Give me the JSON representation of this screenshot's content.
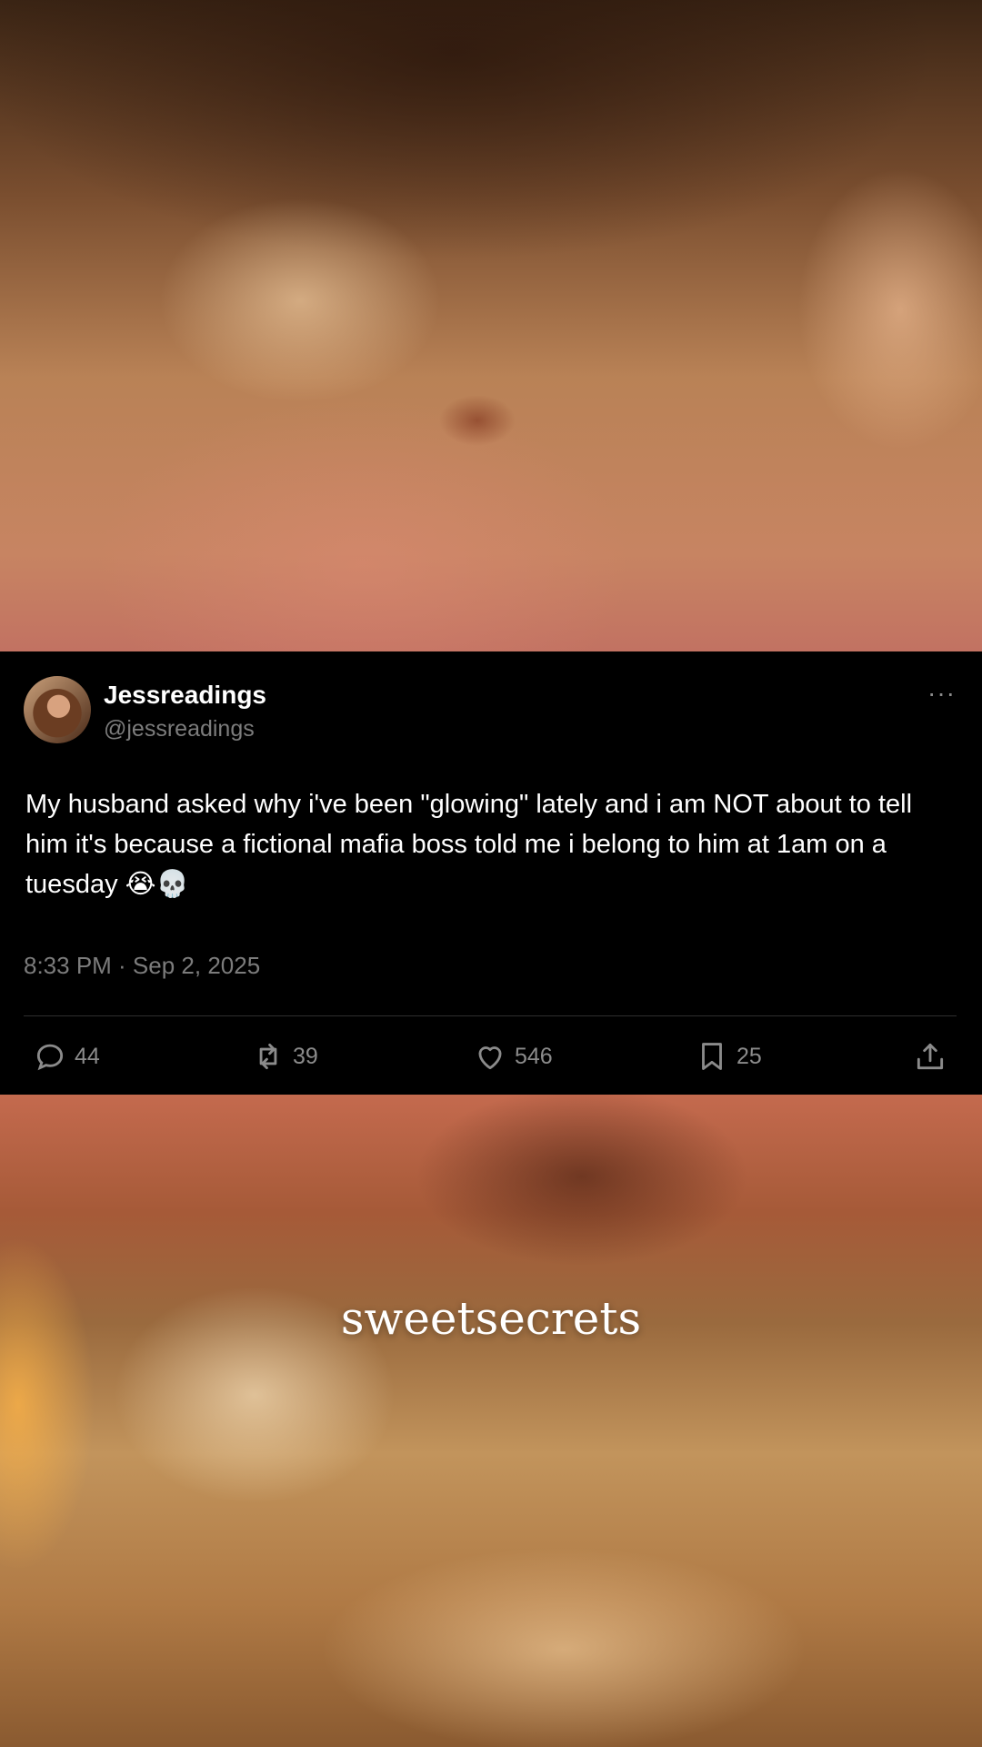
{
  "post": {
    "display_name": "Jessreadings",
    "handle": "@jessreadings",
    "more_label": "···",
    "text": "My husband asked why i've been \"glowing\" lately and i am NOT about to tell him it's because a fictional mafia boss told me i belong to him at 1am on a tuesday 😭💀",
    "timestamp": "8:33 PM · Sep 2, 2025",
    "actions": {
      "reply_count": "44",
      "retweet_count": "39",
      "like_count": "546",
      "bookmark_count": "25"
    },
    "icons": [
      "reply-icon",
      "retweet-icon",
      "heart-icon",
      "bookmark-icon",
      "share-icon"
    ]
  },
  "watermark": "sweetsecrets",
  "colors": {
    "background": "#000000",
    "muted_text": "#7c7c7c",
    "divider": "#2f2f2f"
  }
}
